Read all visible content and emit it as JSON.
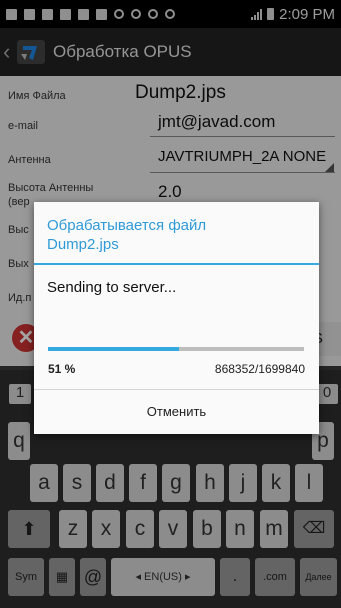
{
  "status_bar": {
    "time": "2:09 PM"
  },
  "app": {
    "title": "Обработка OPUS"
  },
  "form": {
    "file_label": "Имя Файла",
    "file_value": "Dump2.jps",
    "email_label": "e-mail",
    "email_value": "jmt@javad.com",
    "antenna_label": "Антенна",
    "antenna_value": "JAVTRIUMPH_2A NONE",
    "height_label": "Высота Антенны",
    "height_label_cut": "(вер",
    "height_value": "2.0",
    "row5_label": "Выс",
    "row6_label": "Вых",
    "row7_label": "Ид.п",
    "send_fragment": "US"
  },
  "keyboard": {
    "numbers": [
      "1",
      "0"
    ],
    "row2": [
      "a",
      "s",
      "d",
      "f",
      "g",
      "h",
      "j",
      "k",
      "l"
    ],
    "row3": [
      "z",
      "x",
      "c",
      "v",
      "b",
      "n",
      "m"
    ],
    "sym": "Sym",
    "at": "@",
    "lang": "◂ EN(US) ▸",
    "dotcom": ".com",
    "next": "Далее"
  },
  "dialog": {
    "title_line1": "Обрабатывается файл",
    "title_line2": "Dump2.jps",
    "message": "Sending to server...",
    "progress_fraction": 0.51,
    "progress_percent": "51 %",
    "progress_counter": "868352/1699840",
    "cancel_label": "Отменить",
    "accent_color": "#33a9e0"
  }
}
